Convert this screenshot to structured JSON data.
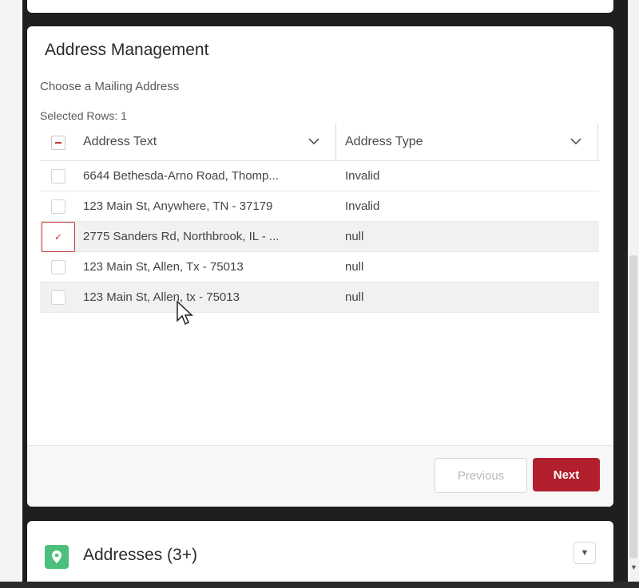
{
  "address_management": {
    "title": "Address Management",
    "subtitle": "Choose a Mailing Address",
    "selected_rows": "Selected Rows: 1",
    "columns": [
      "Address Text",
      "Address Type"
    ],
    "rows": [
      {
        "address": "6644 Bethesda-Arno Road, Thomp...",
        "type": "Invalid",
        "checked": false
      },
      {
        "address": "123 Main St, Anywhere, TN - 37179",
        "type": "Invalid",
        "checked": false
      },
      {
        "address": "2775 Sanders Rd, Northbrook, IL - ...",
        "type": "null",
        "checked": true
      },
      {
        "address": "123 Main St, Allen, Tx - 75013",
        "type": "null",
        "checked": false
      },
      {
        "address": "123 Main St, Allen, tx - 75013",
        "type": "null",
        "checked": false
      }
    ],
    "buttons": {
      "previous": "Previous",
      "next": "Next"
    }
  },
  "addresses_card": {
    "title": "Addresses (3+)",
    "icon": "map-pin-icon"
  },
  "colors": {
    "accent": "#b21f2d",
    "icon_green": "#4bbf7b"
  }
}
